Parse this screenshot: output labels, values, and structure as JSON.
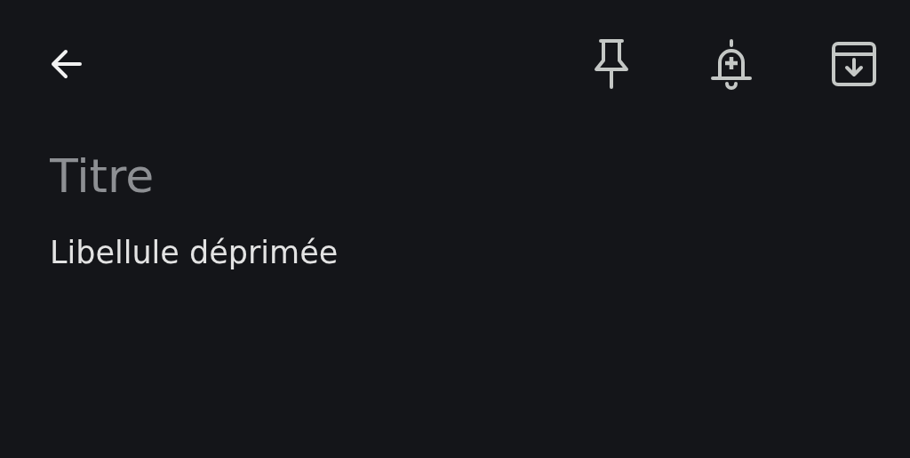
{
  "toolbar": {
    "buttons": [
      {
        "kind": "back"
      },
      {
        "kind": "pin"
      },
      {
        "kind": "reminder"
      },
      {
        "kind": "archive"
      }
    ]
  },
  "note": {
    "title": {
      "placeholder": "Titre"
    },
    "body": {
      "value": "Libellule déprimée"
    }
  }
}
